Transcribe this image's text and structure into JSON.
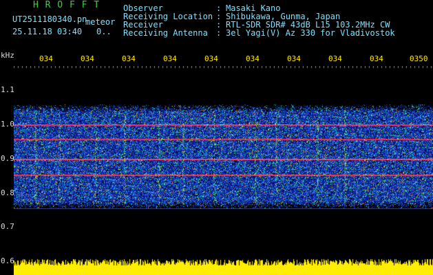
{
  "header": {
    "app_name": "H R O F F T",
    "filename": "UT2511180340.pn",
    "tag": "meteor",
    "datetime": "25.11.18 03:40",
    "zoom": "0..",
    "fields": [
      {
        "label": "Observer",
        "value": "Masaki Kano"
      },
      {
        "label": "Receiving Location",
        "value": "Shibukawa, Gunma, Japan"
      },
      {
        "label": "Receiver",
        "value": "RTL-SDR SDR# 43dB L15 103.2MHz CW"
      },
      {
        "label": "Receiving Antenna",
        "value": "3el Yagi(V) Az 330 for Vladivostok"
      }
    ],
    "separator": ":"
  },
  "axes": {
    "unit": "kHz",
    "y_labels": [
      "1.1",
      "1.0",
      "0.9",
      "0.8",
      "0.7",
      "0.6"
    ],
    "x_labels": [
      "034",
      "034",
      "034",
      "034",
      "034",
      "034",
      "034",
      "034",
      "034",
      "0350"
    ]
  },
  "colors": {
    "app_name": "#3cd03c",
    "header_text": "#7fe0ff",
    "ticks": "#ffe800",
    "signal_bar": "#ffee00"
  }
}
